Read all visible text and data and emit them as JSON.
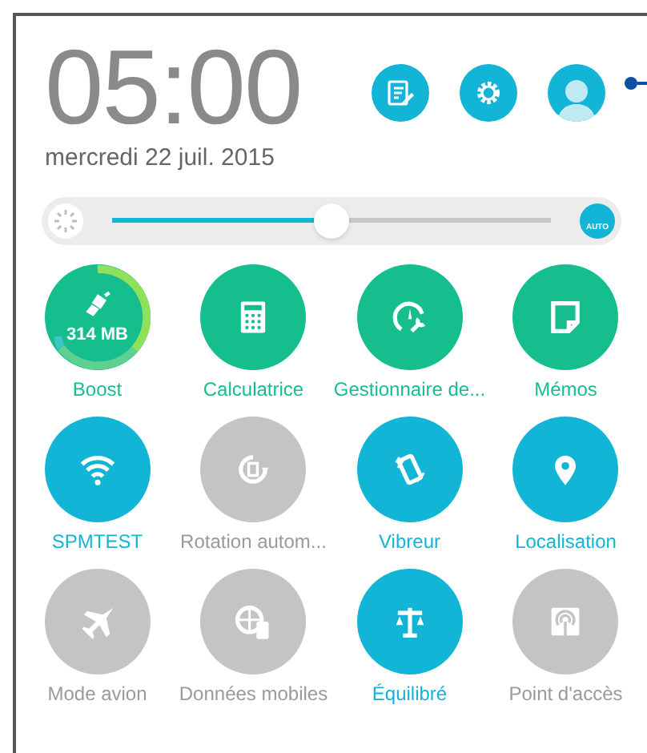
{
  "clock": {
    "time": "05:00",
    "date": "mercredi 22 juil. 2015"
  },
  "brightness": {
    "level": 0.5,
    "auto_label": "AUTO"
  },
  "tiles": [
    {
      "kind": "boost",
      "label": "Boost",
      "reading": "314 MB"
    },
    {
      "kind": "app",
      "label": "Calculatrice"
    },
    {
      "kind": "app",
      "label": "Gestionnaire de..."
    },
    {
      "kind": "app",
      "label": "Mémos"
    },
    {
      "kind": "toggle",
      "label": "SPMTEST",
      "on": true
    },
    {
      "kind": "toggle",
      "label": "Rotation autom...",
      "on": false
    },
    {
      "kind": "toggle",
      "label": "Vibreur",
      "on": true
    },
    {
      "kind": "toggle",
      "label": "Localisation",
      "on": true
    },
    {
      "kind": "toggle",
      "label": "Mode avion",
      "on": false
    },
    {
      "kind": "toggle",
      "label": "Données mobiles",
      "on": false
    },
    {
      "kind": "toggle",
      "label": "Équilibré",
      "on": true
    },
    {
      "kind": "toggle",
      "label": "Point d'accès",
      "on": false
    }
  ]
}
